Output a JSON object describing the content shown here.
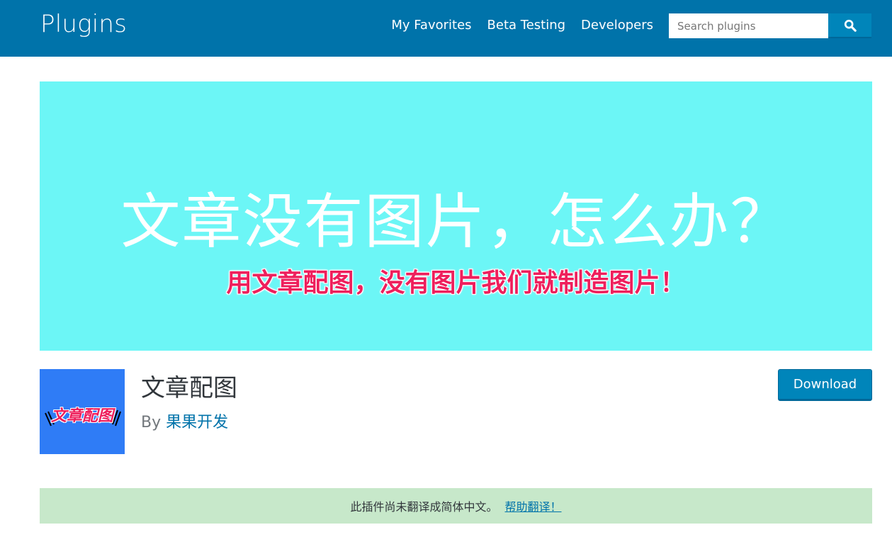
{
  "header": {
    "title": "Plugins",
    "nav": [
      "My Favorites",
      "Beta Testing",
      "Developers"
    ],
    "search": {
      "placeholder": "Search plugins",
      "value": ""
    },
    "search_icon": "search-icon",
    "bg_color": "#0073aa"
  },
  "banner": {
    "headline": "文章没有图片，怎么办？",
    "subline": "用文章配图，没有图片我们就制造图片！",
    "bg_color": "#6cf6f6",
    "headline_color": "#ffffff",
    "subline_color": "#ee1f5c"
  },
  "plugin": {
    "icon_text": "文章配图",
    "icon_bg": "#2f7cf6",
    "title": "文章配图",
    "by_label": "By",
    "author": "果果开发",
    "download_label": "Download"
  },
  "notice": {
    "text": "此插件尚未翻译成简体中文。",
    "link": "帮助翻译！",
    "bg_color": "#c7e8ca"
  }
}
